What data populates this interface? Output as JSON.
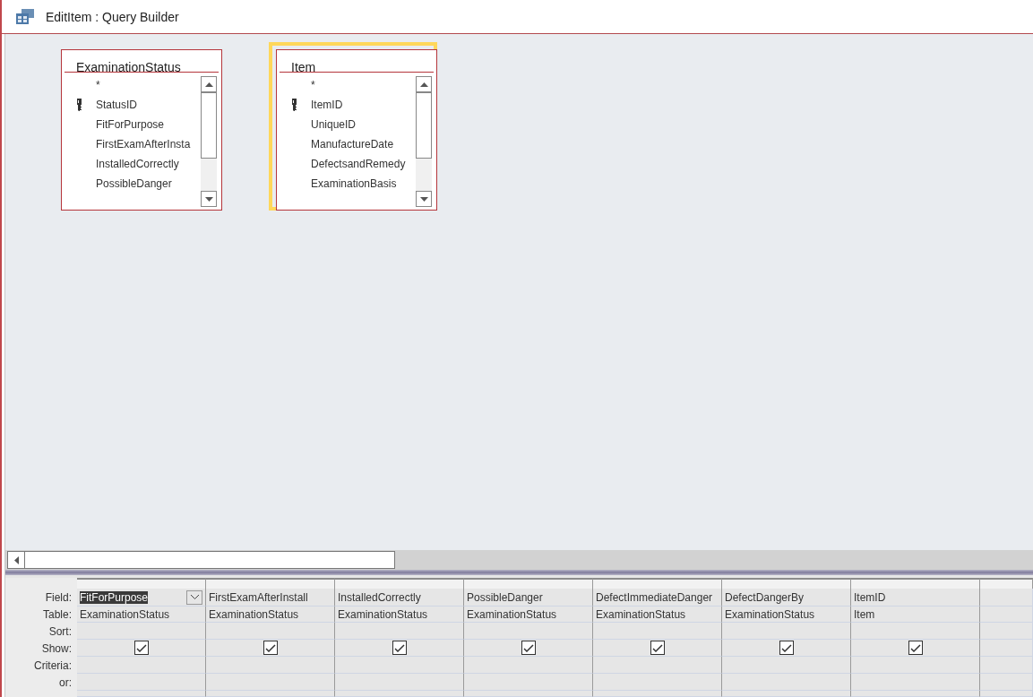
{
  "window": {
    "title": "EditItem : Query Builder"
  },
  "tables": [
    {
      "name": "ExaminationStatus",
      "selected": false,
      "fields": [
        {
          "name": "*",
          "primary_key": false
        },
        {
          "name": "StatusID",
          "primary_key": true
        },
        {
          "name": "FitForPurpose",
          "primary_key": false
        },
        {
          "name": "FirstExamAfterInsta",
          "primary_key": false
        },
        {
          "name": "InstalledCorrectly",
          "primary_key": false
        },
        {
          "name": "PossibleDanger",
          "primary_key": false
        }
      ]
    },
    {
      "name": "Item",
      "selected": true,
      "fields": [
        {
          "name": "*",
          "primary_key": false
        },
        {
          "name": "ItemID",
          "primary_key": true
        },
        {
          "name": "UniqueID",
          "primary_key": false
        },
        {
          "name": "ManufactureDate",
          "primary_key": false
        },
        {
          "name": "DefectsandRemedy",
          "primary_key": false
        },
        {
          "name": "ExaminationBasis",
          "primary_key": false
        }
      ]
    }
  ],
  "grid": {
    "row_labels": [
      "Field:",
      "Table:",
      "Sort:",
      "Show:",
      "Criteria:",
      "or:"
    ],
    "columns": [
      {
        "field": "FitForPurpose",
        "table": "ExaminationStatus",
        "show": true,
        "selected": true
      },
      {
        "field": "FirstExamAfterInstall",
        "table": "ExaminationStatus",
        "show": true,
        "selected": false
      },
      {
        "field": "InstalledCorrectly",
        "table": "ExaminationStatus",
        "show": true,
        "selected": false
      },
      {
        "field": "PossibleDanger",
        "table": "ExaminationStatus",
        "show": true,
        "selected": false
      },
      {
        "field": "DefectImmediateDanger",
        "table": "ExaminationStatus",
        "show": true,
        "selected": false
      },
      {
        "field": "DefectDangerBy",
        "table": "ExaminationStatus",
        "show": true,
        "selected": false
      },
      {
        "field": "ItemID",
        "table": "Item",
        "show": true,
        "selected": false
      }
    ]
  }
}
